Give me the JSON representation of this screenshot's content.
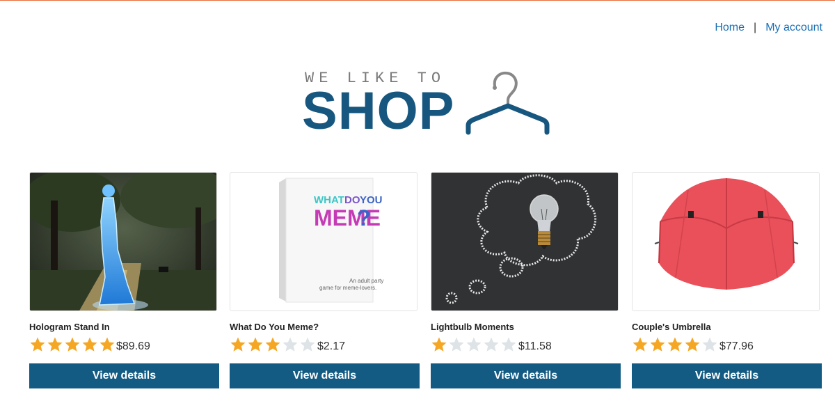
{
  "nav": {
    "home": "Home",
    "separator": "|",
    "account": "My account"
  },
  "logo": {
    "tagline": "WE LIKE TO",
    "title": "SHOP",
    "icon": "hanger-icon"
  },
  "colors": {
    "brand": "#17577f",
    "button": "#135b83",
    "link": "#1a6fb3",
    "star_on": "#f5a623",
    "star_off": "#dde3e6",
    "top_line": "#e86d3c"
  },
  "products": [
    {
      "name": "Hologram Stand In",
      "rating": 5,
      "rating_max": 5,
      "price": "$89.69",
      "button": "View details"
    },
    {
      "name": "What Do You Meme?",
      "rating": 3,
      "rating_max": 5,
      "price": "$2.17",
      "button": "View details",
      "box_text": {
        "line1_a": "WHAT",
        "line1_b": "DO",
        "line1_c": "YOU",
        "line2": "MEME",
        "line2_q": "?",
        "sub1": "An adult party",
        "sub2": "game for meme-lovers."
      }
    },
    {
      "name": "Lightbulb Moments",
      "rating": 1,
      "rating_max": 5,
      "price": "$11.58",
      "button": "View details"
    },
    {
      "name": "Couple's Umbrella",
      "rating": 4,
      "rating_max": 5,
      "price": "$77.96",
      "button": "View details"
    }
  ]
}
